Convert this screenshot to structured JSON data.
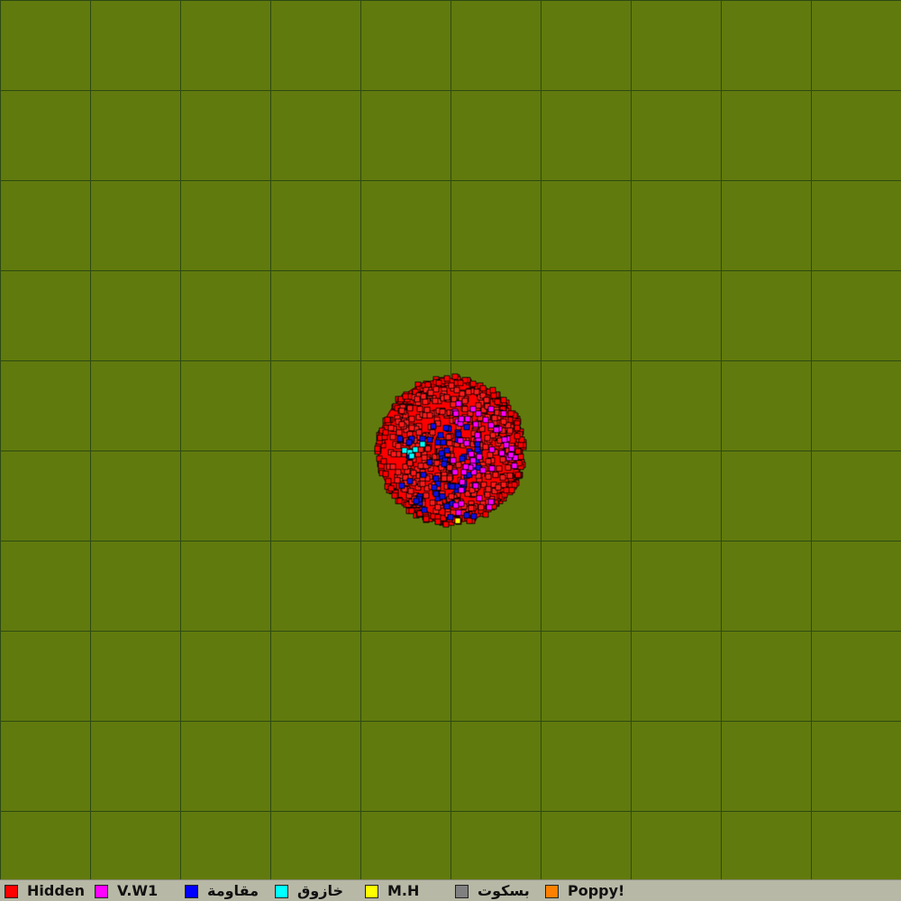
{
  "map": {
    "background": "#617a0d",
    "grid_color": "#2d4a12"
  },
  "legend": {
    "items": [
      {
        "label": "Hidden",
        "color": "#ff0000"
      },
      {
        "label": "V.W1",
        "color": "#ff00ff"
      },
      {
        "label": "مقاومة",
        "color": "#0000ff"
      },
      {
        "label": "خازوق",
        "color": "#00ffff"
      },
      {
        "label": "M.H",
        "color": "#ffff00"
      },
      {
        "label": "بسكوت",
        "color": "#808080"
      },
      {
        "label": "Poppy!",
        "color": "#ff8000"
      }
    ]
  }
}
